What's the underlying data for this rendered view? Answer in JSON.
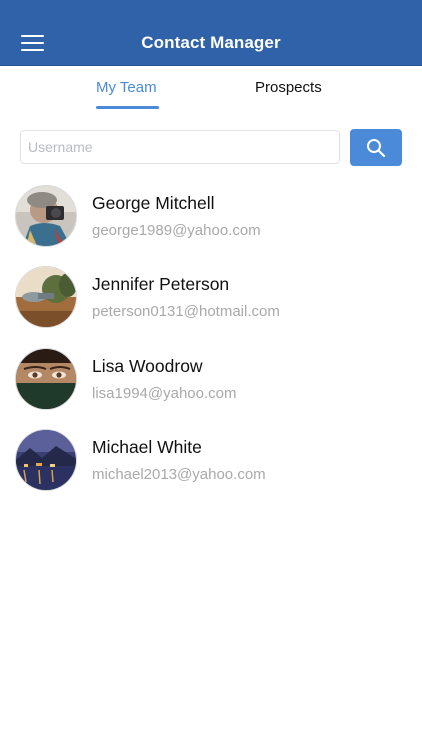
{
  "header": {
    "title": "Contact Manager",
    "menu_icon": "hamburger-icon",
    "background": "#2f62a8"
  },
  "tabs": [
    {
      "label": "My Team",
      "active": true
    },
    {
      "label": "Prospects",
      "active": false
    }
  ],
  "accent_color": "#4a8ad8",
  "search": {
    "placeholder": "Username",
    "value": "",
    "button_icon": "search-icon"
  },
  "contacts": [
    {
      "name": "George Mitchell",
      "email": "george1989@yahoo.com",
      "avatar": "photo of a man with a camera"
    },
    {
      "name": "Jennifer Peterson",
      "email": "peterson0131@hotmail.com",
      "avatar": "landscape with trees and field"
    },
    {
      "name": "Lisa Woodrow",
      "email": "lisa1994@yahoo.com",
      "avatar": "woman's eyes above a veil"
    },
    {
      "name": "Michael White",
      "email": "michael2013@yahoo.com",
      "avatar": "lake at night with lights"
    }
  ]
}
